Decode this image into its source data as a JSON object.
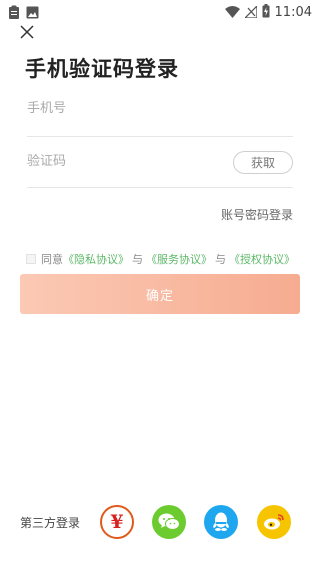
{
  "status_bar": {
    "time": "11:04",
    "icons": [
      "clipboard-icon",
      "image-icon",
      "wifi-icon",
      "no-signal-icon",
      "battery-charging-icon"
    ]
  },
  "header": {
    "close_icon": "close-icon",
    "title": "手机验证码登录"
  },
  "form": {
    "phone_placeholder": "手机号",
    "code_placeholder": "验证码",
    "get_code_label": "获取",
    "password_login_label": "账号密码登录",
    "agreement": {
      "prefix": "同意",
      "privacy_label": "《隐私协议》",
      "connector_1": "与",
      "service_label": "《服务协议》",
      "connector_2": "与",
      "auth_label": "《授权协议》"
    },
    "confirm_label": "确定"
  },
  "third_party": {
    "label": "第三方登录",
    "providers": [
      "yuan-icon",
      "wechat-icon",
      "qq-icon",
      "weibo-icon"
    ]
  },
  "colors": {
    "accent_gradient_start": "#fbc9b4",
    "accent_gradient_end": "#f6ac91",
    "link_green": "#5cb868",
    "wechat": "#6ccb2f",
    "qq": "#1ea6ee",
    "weibo": "#f7c400"
  }
}
